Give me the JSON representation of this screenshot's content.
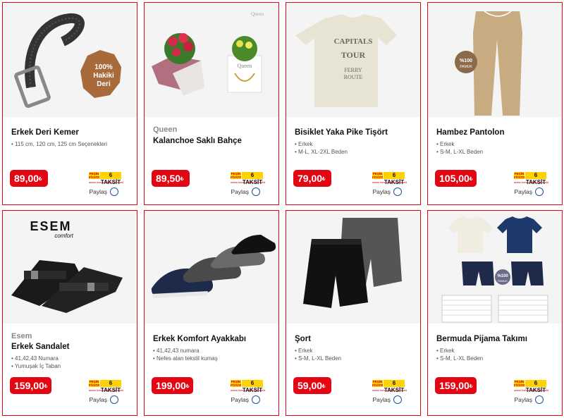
{
  "cards": [
    {
      "brand": "",
      "title": "Erkek Deri Kemer",
      "features": [
        "115 cm, 120 cm, 125 cm Seçenekleri"
      ],
      "price_int": "89",
      "price_dec": ",00",
      "currency": "₺",
      "image": "belt"
    },
    {
      "brand": "Queen",
      "title": "Kalanchoe Saklı Bahçe",
      "features": [],
      "price_int": "89",
      "price_dec": ",50",
      "currency": "₺",
      "image": "flowers"
    },
    {
      "brand": "",
      "title": "Bisiklet Yaka Pike Tişört",
      "features": [
        "Erkek",
        "M-L, XL-2XL Beden"
      ],
      "price_int": "79",
      "price_dec": ",00",
      "currency": "₺",
      "image": "tshirt"
    },
    {
      "brand": "",
      "title": "Hambez Pantolon",
      "features": [
        "Erkek",
        "S-M, L-XL Beden"
      ],
      "price_int": "105",
      "price_dec": ",00",
      "currency": "₺",
      "image": "pants"
    },
    {
      "brand": "Esem",
      "title": "Erkek Sandalet",
      "features": [
        "41,42,43 Numara",
        "Yumuşak İç Taban"
      ],
      "price_int": "159",
      "price_dec": ",00",
      "currency": "₺",
      "image": "sandals"
    },
    {
      "brand": "",
      "title": "Erkek Komfort Ayakkabı",
      "features": [
        "41,42,43 numara",
        "Nefes alan tekstil kumaş"
      ],
      "price_int": "199",
      "price_dec": ",00",
      "currency": "₺",
      "image": "shoes"
    },
    {
      "brand": "",
      "title": "Şort",
      "features": [
        "Erkek",
        "S-M, L-XL Beden"
      ],
      "price_int": "59",
      "price_dec": ",00",
      "currency": "₺",
      "image": "shorts"
    },
    {
      "brand": "",
      "title": "Bermuda Pijama Takımı",
      "features": [
        "Erkek",
        "S-M, L-XL Beden"
      ],
      "price_int": "159",
      "price_dec": ",00",
      "currency": "₺",
      "image": "pajama"
    }
  ],
  "badge": {
    "pesin": "PEŞİN FİYATINA",
    "count": "6 TAKSİT",
    "banks": "axess bonus maximum world"
  },
  "share_label": "Paylaş",
  "image_text": {
    "leather_badge": [
      "100%",
      "Hakiki",
      "Deri"
    ],
    "queen_logo": "Queen",
    "tshirt_print": [
      "CAPITALS",
      "TOUR",
      "FERRY",
      "ROUTE"
    ],
    "cotton_badge": [
      "%100",
      "PAMUK"
    ],
    "esem_logo": "ESEM",
    "esem_sub": "comfort",
    "pajama_tags": [
      "%100",
      "PAMUK"
    ]
  },
  "colors": {
    "accent": "#e30613",
    "share": "#1e4fa0"
  }
}
